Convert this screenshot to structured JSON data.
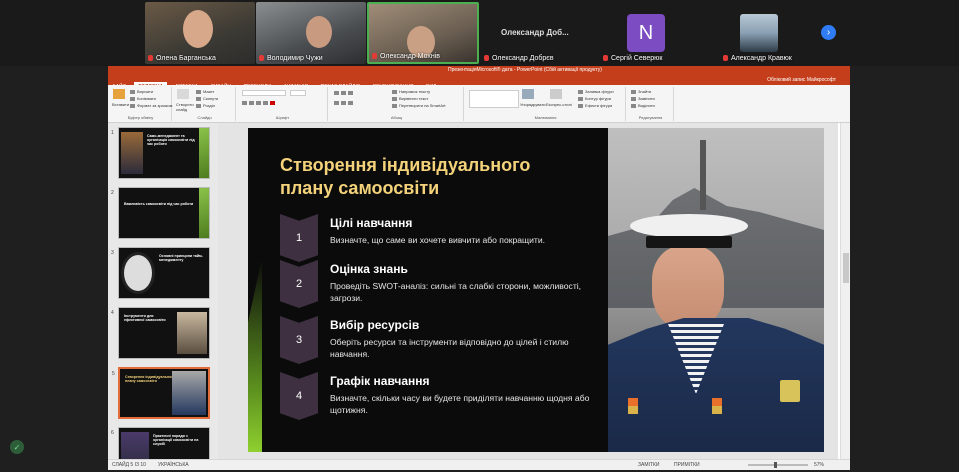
{
  "participants": [
    {
      "name": "Олена Барганська"
    },
    {
      "name": "Володимир Чужи"
    },
    {
      "name": "Олександр Мохнів"
    },
    {
      "name": "Олександр Добрєв",
      "display_label": "Олександр Доб..."
    },
    {
      "name": "Сергій Северюк",
      "avatar_letter": "N"
    },
    {
      "name": "Александр Кравюк"
    }
  ],
  "ppt": {
    "title": "ПрезентаціяMicrosoft® дата - PowerPoint (Сбій активації продукту)",
    "tabs": [
      "ФАЙЛ",
      "ГОЛОВНА",
      "ВСТАВКА",
      "ДИЗАЙН",
      "ПЕРЕХОДИ",
      "АНІМАЦІЯ",
      "ПОКАЗ СЛАЙДІВ",
      "РЕЦЕНЗУВАННЯ",
      "ВИД"
    ],
    "active_tab": "ГОЛОВНА",
    "account": "Обліковий запис Майкрософт",
    "ribbon": {
      "paste": "Вставити",
      "cut": "Вирізати",
      "copy": "Копіювати",
      "format_painter": "Формат за зразком",
      "clipboard_group": "Буфер обміну",
      "new_slide": "Створити слайд",
      "layout": "Макет",
      "reset": "Скинути",
      "section": "Розділ",
      "slides_group": "Слайди",
      "font_group": "Шрифт",
      "text_direction": "Напрямок тексту",
      "align_text": "Вирівняти текст",
      "smartart": "Перетворити на SmartArt",
      "paragraph_group": "Абзац",
      "arrange": "Упорядкувати",
      "quick_styles": "Експрес-стилі",
      "shape_fill": "Заливка фігури",
      "shape_outline": "Контур фігури",
      "shape_effects": "Ефекти фігури",
      "drawing_group": "Малювання",
      "find": "Знайти",
      "replace": "Замінити",
      "select": "Виділити",
      "editing_group": "Редагування"
    },
    "thumbnails": [
      {
        "num": "1",
        "text": "Само-менеджмент та організація самоосвіти під час роботи"
      },
      {
        "num": "2",
        "text": "Важливість самоосвіти під час роботи"
      },
      {
        "num": "3",
        "text": "Основні принципи тайм-менеджменту"
      },
      {
        "num": "4",
        "text": "Інструменти для ефективної самоосвіти"
      },
      {
        "num": "5",
        "text": "Створення індивідуального плану самоосвіти"
      },
      {
        "num": "6",
        "text": "Практичні поради з організації самоосвіти на службі"
      }
    ],
    "selected_thumbnail": "5",
    "statusbar": {
      "slide_info": "СЛАЙД 5 ІЗ 10",
      "language": "УКРАЇНСЬКА",
      "notes": "ЗАМІТКИ",
      "comments": "ПРИМІТКИ",
      "zoom": "57%"
    }
  },
  "slide": {
    "title": "Створення індивідуального плану самоосвіти",
    "steps": [
      {
        "number": "1",
        "heading": "Цілі навчання",
        "text": "Визначте, що саме ви хочете вивчити або покращити."
      },
      {
        "number": "2",
        "heading": "Оцінка знань",
        "text": "Проведіть SWOT-аналіз: сильні та слабкі сторони, можливості, загрози."
      },
      {
        "number": "3",
        "heading": "Вибір ресурсів",
        "text": "Оберіть ресурси та інструменти відповідно до цілей і стилю навчання."
      },
      {
        "number": "4",
        "heading": "Графік навчання",
        "text": "Визначте, скільки часу ви будете приділяти навчанню щодня або щотижня."
      }
    ]
  },
  "colors": {
    "ppt_accent": "#c43e1c",
    "slide_title": "#f3d27a",
    "chevron": "#3e3040",
    "green_accent": "#8fcf2f",
    "avatar_n": "#7b4cc2",
    "active_speaker": "#4caf50"
  }
}
